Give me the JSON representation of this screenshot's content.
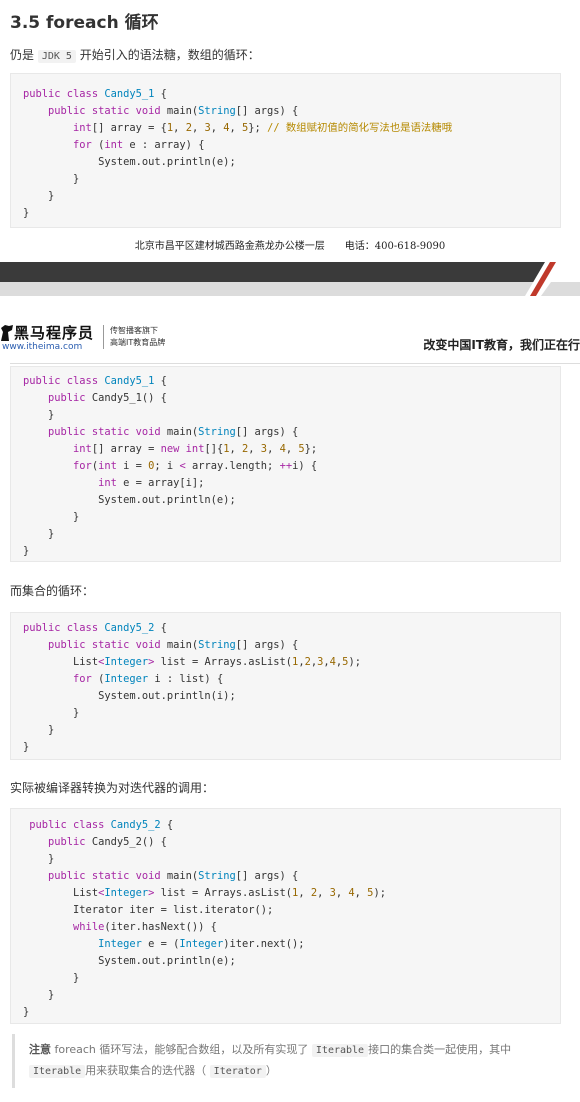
{
  "section_title": "3.5 foreach 循环",
  "intro": {
    "prefix": "仍是",
    "code": "JDK 5",
    "suffix": "开始引入的语法糖，数组的循环："
  },
  "code1": [
    [
      {
        "c": "k",
        "t": "public class "
      },
      {
        "c": "t",
        "t": "Candy5_1"
      },
      {
        "t": " {"
      }
    ],
    [
      {
        "t": "    "
      },
      {
        "c": "k",
        "t": "public static void "
      },
      {
        "t": "main("
      },
      {
        "c": "t",
        "t": "String"
      },
      {
        "t": "[] args) {"
      }
    ],
    [
      {
        "t": "        "
      },
      {
        "c": "k",
        "t": "int"
      },
      {
        "t": "[] array = {"
      },
      {
        "c": "n",
        "t": "1"
      },
      {
        "t": ", "
      },
      {
        "c": "n",
        "t": "2"
      },
      {
        "t": ", "
      },
      {
        "c": "n",
        "t": "3"
      },
      {
        "t": ", "
      },
      {
        "c": "n",
        "t": "4"
      },
      {
        "t": ", "
      },
      {
        "c": "n",
        "t": "5"
      },
      {
        "t": "}; "
      },
      {
        "c": "c",
        "t": "// 数组赋初值的简化写法也是语法糖哦"
      }
    ],
    [
      {
        "t": "        "
      },
      {
        "c": "k",
        "t": "for "
      },
      {
        "t": "("
      },
      {
        "c": "k",
        "t": "int "
      },
      {
        "t": "e : array) {"
      }
    ],
    [
      {
        "t": "            System.out.println(e);"
      }
    ],
    [
      {
        "t": "        }"
      }
    ],
    [
      {
        "t": "    }"
      }
    ],
    [
      {
        "t": "}"
      }
    ]
  ],
  "footer_address": "北京市昌平区建材城西路金燕龙办公楼一层　　电话：400-618-9090",
  "header": {
    "logo_name": "黑马程序员",
    "logo_url": "www.itheima.com",
    "tagline1": "传智播客旗下",
    "tagline2": "高端IT教育品牌",
    "slogan": "改变中国IT教育，我们正在行"
  },
  "code2": [
    [
      {
        "c": "k",
        "t": "public class "
      },
      {
        "c": "t",
        "t": "Candy5_1"
      },
      {
        "t": " {"
      }
    ],
    [
      {
        "t": "    "
      },
      {
        "c": "k",
        "t": "public "
      },
      {
        "t": "Candy5_1() {"
      }
    ],
    [
      {
        "t": "    }"
      }
    ],
    [
      {
        "t": "    "
      },
      {
        "c": "k",
        "t": "public static void "
      },
      {
        "t": "main("
      },
      {
        "c": "t",
        "t": "String"
      },
      {
        "t": "[] args) {"
      }
    ],
    [
      {
        "t": "        "
      },
      {
        "c": "k",
        "t": "int"
      },
      {
        "t": "[] array = "
      },
      {
        "c": "k",
        "t": "new int"
      },
      {
        "t": "[]{"
      },
      {
        "c": "n",
        "t": "1"
      },
      {
        "t": ", "
      },
      {
        "c": "n",
        "t": "2"
      },
      {
        "t": ", "
      },
      {
        "c": "n",
        "t": "3"
      },
      {
        "t": ", "
      },
      {
        "c": "n",
        "t": "4"
      },
      {
        "t": ", "
      },
      {
        "c": "n",
        "t": "5"
      },
      {
        "t": "};"
      }
    ],
    [
      {
        "t": "        "
      },
      {
        "c": "k",
        "t": "for"
      },
      {
        "t": "("
      },
      {
        "c": "k",
        "t": "int "
      },
      {
        "t": "i = "
      },
      {
        "c": "n",
        "t": "0"
      },
      {
        "t": "; i "
      },
      {
        "c": "k",
        "t": "<"
      },
      {
        "t": " array.length; "
      },
      {
        "c": "k",
        "t": "++"
      },
      {
        "t": "i) {"
      }
    ],
    [
      {
        "t": "            "
      },
      {
        "c": "k",
        "t": "int "
      },
      {
        "t": "e = array[i];"
      }
    ],
    [
      {
        "t": "            System.out.println(e);"
      }
    ],
    [
      {
        "t": "        }"
      }
    ],
    [
      {
        "t": "    }"
      }
    ],
    [
      {
        "t": "}"
      }
    ]
  ],
  "set_loop_label": "而集合的循环：",
  "code3": [
    [
      {
        "c": "k",
        "t": "public class "
      },
      {
        "c": "t",
        "t": "Candy5_2"
      },
      {
        "t": " {"
      }
    ],
    [
      {
        "t": "    "
      },
      {
        "c": "k",
        "t": "public static void "
      },
      {
        "t": "main("
      },
      {
        "c": "t",
        "t": "String"
      },
      {
        "t": "[] args) {"
      }
    ],
    [
      {
        "t": "        List"
      },
      {
        "c": "k",
        "t": "<"
      },
      {
        "c": "t",
        "t": "Integer"
      },
      {
        "c": "k",
        "t": ">"
      },
      {
        "t": " list = Arrays.asList("
      },
      {
        "c": "n",
        "t": "1"
      },
      {
        "t": ","
      },
      {
        "c": "n",
        "t": "2"
      },
      {
        "t": ","
      },
      {
        "c": "n",
        "t": "3"
      },
      {
        "t": ","
      },
      {
        "c": "n",
        "t": "4"
      },
      {
        "t": ","
      },
      {
        "c": "n",
        "t": "5"
      },
      {
        "t": ");"
      }
    ],
    [
      {
        "t": "        "
      },
      {
        "c": "k",
        "t": "for "
      },
      {
        "t": "("
      },
      {
        "c": "t",
        "t": "Integer "
      },
      {
        "t": "i : list) {"
      }
    ],
    [
      {
        "t": "            System.out.println(i);"
      }
    ],
    [
      {
        "t": "        }"
      }
    ],
    [
      {
        "t": "    }"
      }
    ],
    [
      {
        "t": "}"
      }
    ]
  ],
  "iterator_label": "实际被编译器转换为对迭代器的调用：",
  "code4": [
    [
      {
        "t": " "
      },
      {
        "c": "k",
        "t": "public class "
      },
      {
        "c": "t",
        "t": "Candy5_2"
      },
      {
        "t": " {"
      }
    ],
    [
      {
        "t": "    "
      },
      {
        "c": "k",
        "t": "public "
      },
      {
        "t": "Candy5_2() {"
      }
    ],
    [
      {
        "t": "    }"
      }
    ],
    [
      {
        "t": "    "
      },
      {
        "c": "k",
        "t": "public static void "
      },
      {
        "t": "main("
      },
      {
        "c": "t",
        "t": "String"
      },
      {
        "t": "[] args) {"
      }
    ],
    [
      {
        "t": "        List"
      },
      {
        "c": "k",
        "t": "<"
      },
      {
        "c": "t",
        "t": "Integer"
      },
      {
        "c": "k",
        "t": ">"
      },
      {
        "t": " list = Arrays.asList("
      },
      {
        "c": "n",
        "t": "1"
      },
      {
        "t": ", "
      },
      {
        "c": "n",
        "t": "2"
      },
      {
        "t": ", "
      },
      {
        "c": "n",
        "t": "3"
      },
      {
        "t": ", "
      },
      {
        "c": "n",
        "t": "4"
      },
      {
        "t": ", "
      },
      {
        "c": "n",
        "t": "5"
      },
      {
        "t": ");"
      }
    ],
    [
      {
        "t": "        Iterator iter = list.iterator();"
      }
    ],
    [
      {
        "t": "        "
      },
      {
        "c": "k",
        "t": "while"
      },
      {
        "t": "(iter.hasNext()) {"
      }
    ],
    [
      {
        "t": "            "
      },
      {
        "c": "t",
        "t": "Integer "
      },
      {
        "t": "e = ("
      },
      {
        "c": "t",
        "t": "Integer"
      },
      {
        "t": ")iter.next();"
      }
    ],
    [
      {
        "t": "            System.out.println(e);"
      }
    ],
    [
      {
        "t": "        }"
      }
    ],
    [
      {
        "t": "    }"
      }
    ],
    [
      {
        "t": "}"
      }
    ]
  ],
  "note": {
    "bold": "注意",
    "text1": " foreach 循环写法，能够配合数组，以及所有实现了",
    "code1": "Iterable",
    "text2": "接口的集合类一起使用，其中",
    "code2": "Iterable",
    "text3": "用来获取集合的迭代器（",
    "code3": "Iterator",
    "text4": "）"
  },
  "colors": {
    "keyword": "#a626a4",
    "type": "#0184bc",
    "number": "#986801",
    "comment": "#b58900",
    "code_bg": "#f6f6f6",
    "page_bar": "#3a3a3a"
  }
}
